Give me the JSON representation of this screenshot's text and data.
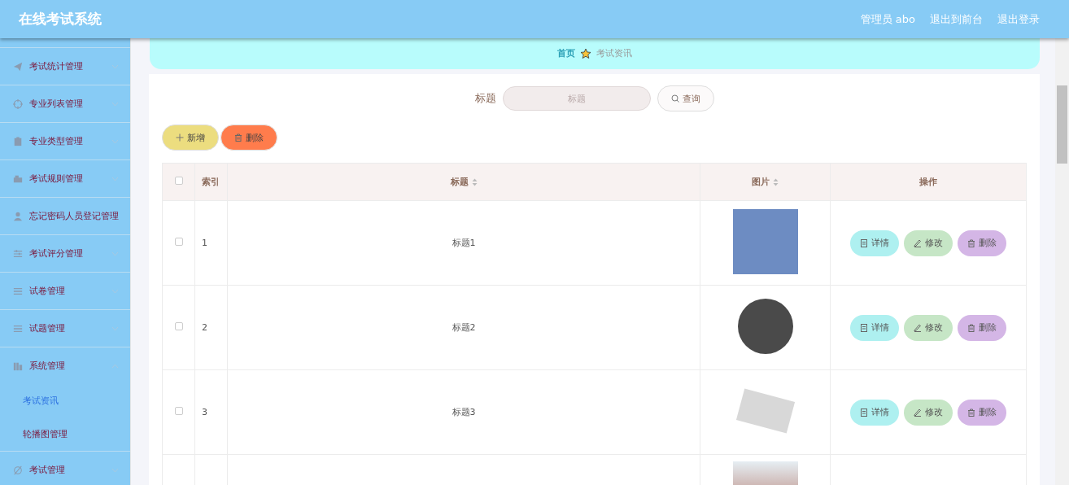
{
  "header": {
    "title": "在线考试系统",
    "user": "管理员 abo",
    "links": [
      "退出到前台",
      "退出登录"
    ]
  },
  "sidebar": {
    "items": [
      {
        "label": "考试统计管理",
        "kind": "group",
        "expanded": false
      },
      {
        "label": "专业列表管理",
        "kind": "group",
        "expanded": false
      },
      {
        "label": "专业类型管理",
        "kind": "group",
        "expanded": false
      },
      {
        "label": "考试规则管理",
        "kind": "group",
        "expanded": false
      },
      {
        "label": "忘记密码人员登记管理",
        "kind": "link"
      },
      {
        "label": "考试评分管理",
        "kind": "group",
        "expanded": false
      },
      {
        "label": "试卷管理",
        "kind": "group",
        "expanded": false
      },
      {
        "label": "试题管理",
        "kind": "group",
        "expanded": false
      },
      {
        "label": "系统管理",
        "kind": "group",
        "expanded": true,
        "children": [
          {
            "label": "考试资讯",
            "selected": true
          },
          {
            "label": "轮播图管理",
            "selected": false
          }
        ]
      },
      {
        "label": "考试管理",
        "kind": "group",
        "expanded": false
      }
    ]
  },
  "breadcrumb": [
    "首页",
    "考试资讯"
  ],
  "search": {
    "label": "标题",
    "placeholder": "标题",
    "button": "查询"
  },
  "actions": [
    "新增",
    "删除"
  ],
  "table": {
    "select_all_checked": false,
    "columns": [
      {
        "label": "索引",
        "sortable": false
      },
      {
        "label": "标题",
        "sortable": true
      },
      {
        "label": "图片",
        "sortable": true
      },
      {
        "label": "操作",
        "sortable": false
      }
    ],
    "rows": [
      {
        "kind": "full",
        "index": "1",
        "title": "标题1",
        "checked": false,
        "buttons": [
          "详情",
          "修改",
          "删除"
        ]
      },
      {
        "kind": "full",
        "index": "2",
        "title": "标题2",
        "checked": false,
        "buttons": [
          "详情",
          "修改",
          "删除"
        ]
      },
      {
        "kind": "full",
        "index": "3",
        "title": "标题3",
        "checked": false,
        "buttons": [
          "详情",
          "修改",
          "删除"
        ]
      },
      {
        "kind": "cut"
      }
    ]
  }
}
